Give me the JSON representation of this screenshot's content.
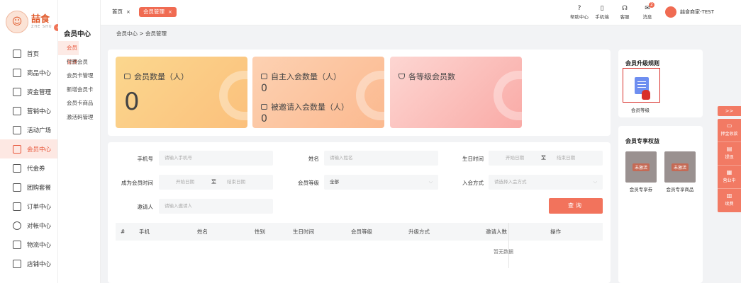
{
  "logo": {
    "cn": "喆食",
    "en": "ZHE SHU",
    "badge": ""
  },
  "nav": [
    {
      "label": "首页",
      "icon": "home-icon"
    },
    {
      "label": "商品中心",
      "icon": "cart-icon"
    },
    {
      "label": "资金管理",
      "icon": "layers-icon"
    },
    {
      "label": "营销中心",
      "icon": "video-icon"
    },
    {
      "label": "活动广场",
      "icon": "box-icon"
    },
    {
      "label": "会员中心",
      "icon": "member-card-icon",
      "active": true
    },
    {
      "label": "代金券",
      "icon": "mail-icon"
    },
    {
      "label": "团购套餐",
      "icon": "bag-icon"
    },
    {
      "label": "订单中心",
      "icon": "order-icon"
    },
    {
      "label": "对帐中心",
      "icon": "yen-icon"
    },
    {
      "label": "物流中心",
      "icon": "package-icon"
    },
    {
      "label": "店铺中心",
      "icon": "shop-icon"
    }
  ],
  "sub_sidebar": {
    "title": "会员中心",
    "items": [
      "会员管理",
      "付费会员",
      "会员卡管理",
      "新增会员卡",
      "会员卡商品",
      "激活码管理"
    ]
  },
  "tabs": {
    "home": "首页",
    "member": "会员管理",
    "close": "×"
  },
  "top_icons": [
    {
      "label": "帮助中心",
      "glyph": "?",
      "icon": "help-icon"
    },
    {
      "label": "手机端",
      "glyph": "▯",
      "icon": "mobile-icon"
    },
    {
      "label": "客服",
      "glyph": "☊",
      "icon": "headset-icon"
    },
    {
      "label": "消息",
      "glyph": "✉",
      "icon": "message-icon",
      "badge": "2"
    }
  ],
  "user": {
    "name": "喆食商家-TEST"
  },
  "breadcrumb": "会员中心 > 会员管理",
  "stats": {
    "member_count_label": "会员数量（人）",
    "member_count_value": "0",
    "self_join_label": "自主入会数量（人）",
    "self_join_value": "0",
    "invited_label": "被邀请入会数量（人）",
    "invited_value": "0",
    "level_label": "各等级会员数"
  },
  "form": {
    "phone_label": "手机号",
    "phone_placeholder": "请输入手机号",
    "name_label": "姓名",
    "name_placeholder": "请输入姓名",
    "birthday_label": "生日时间",
    "start_date": "开始日期",
    "to": "至",
    "end_date": "结束日期",
    "join_time_label": "成为会员时间",
    "level_label": "会员等级",
    "level_value": "全部",
    "join_method_label": "入会方式",
    "join_method_placeholder": "请选择入会方式",
    "inviter_label": "邀请人",
    "inviter_placeholder": "请输入邀请人",
    "query_button": "查询"
  },
  "table": {
    "columns": [
      "#",
      "手机",
      "姓名",
      "性别",
      "生日时间",
      "会员等级",
      "升级方式",
      "邀请人数",
      "操作"
    ],
    "empty": "暂无数据"
  },
  "right_panel": {
    "upgrade_title": "会员升级规则",
    "upgrade_item": "会员等级",
    "perks_title": "会员专享权益",
    "perks": [
      {
        "tag": "未激活",
        "label": "会员专享券"
      },
      {
        "tag": "未激活",
        "label": "会员专享商品"
      }
    ]
  },
  "float_tools": {
    "toggle": ">>",
    "items": [
      {
        "label": "押金收款",
        "glyph": "▭",
        "icon": "deposit-icon"
      },
      {
        "label": "提现",
        "glyph": "▤",
        "icon": "withdraw-icon"
      },
      {
        "label": "营业中",
        "glyph": "▦",
        "icon": "shop-open-icon"
      },
      {
        "label": "续费",
        "glyph": "▥",
        "icon": "renew-icon"
      }
    ]
  },
  "colors": {
    "accent": "#f06b52",
    "active_bg": "#fde8e3"
  }
}
